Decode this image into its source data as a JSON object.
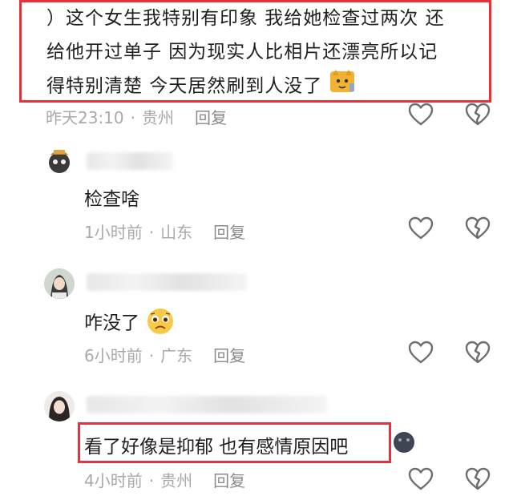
{
  "main_comment": {
    "text_line1": "）这个女生我特别有印象 我给她检查过两次 还",
    "text_line2": "给他开过单子 因为现实人比相片还漂亮所以记",
    "text_line3": "得特别清楚 今天居然刷到人没了",
    "time": "昨天23:10",
    "location": "贵州",
    "reply": "回复"
  },
  "replies": [
    {
      "text": "检查啥",
      "time": "1小时前",
      "location": "山东",
      "reply": "回复"
    },
    {
      "text": "咋没了",
      "time": "6小时前",
      "location": "广东",
      "reply": "回复"
    },
    {
      "text": "看了好像是抑郁 也有感情原因吧",
      "time": "4小时前",
      "location": "贵州",
      "reply": "回复"
    }
  ],
  "separator": "·",
  "colors": {
    "highlight": "#e5323b",
    "meta": "#a9a9a9",
    "text": "#1f1f1f",
    "icon": "#6e6e6e"
  },
  "icons": [
    "heart-outline-icon",
    "broken-heart-icon",
    "cat-sticker-icon",
    "worried-face-emoji",
    "dark-face-emoji"
  ]
}
